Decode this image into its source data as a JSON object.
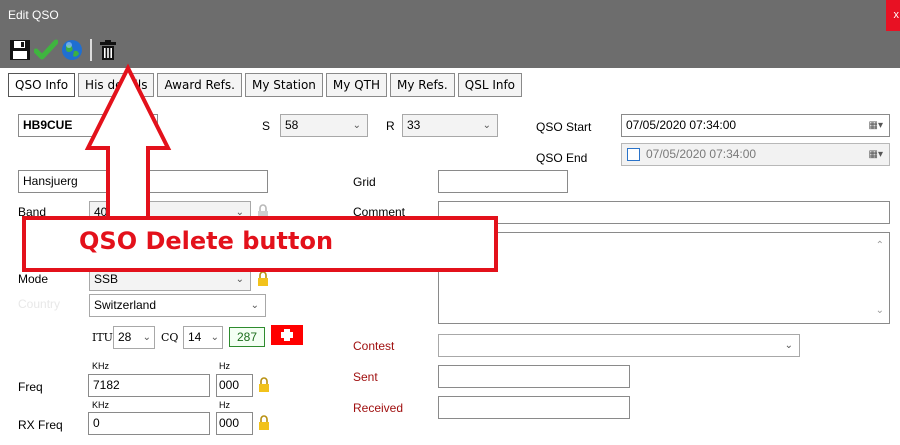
{
  "window": {
    "title": "Edit QSO",
    "close_label": "x"
  },
  "toolbar": {
    "buttons": [
      {
        "name": "save-icon"
      },
      {
        "name": "confirm-check-icon"
      },
      {
        "name": "globe-icon"
      },
      {
        "name": "trash-icon"
      }
    ]
  },
  "tabs": [
    "QSO Info",
    "His details",
    "Award Refs.",
    "My Station",
    "My QTH",
    "My Refs.",
    "QSL Info"
  ],
  "form": {
    "callsign": "HB9CUE",
    "s_label": "S",
    "s_value": "58",
    "r_label": "R",
    "r_value": "33",
    "qso_start_label": "QSO Start",
    "qso_start_value": "07/05/2020 07:34:00",
    "qso_end_label": "QSO End",
    "qso_end_value": "07/05/2020 07:34:00",
    "name": "Hansjuerg",
    "grid_label": "Grid",
    "grid_value": "",
    "band_label": "Band",
    "band_value": "40m",
    "comment_label": "Comment",
    "comment_value": "",
    "mode_label": "Mode",
    "mode_value": "SSB",
    "country_label": "Country",
    "country_value": "Switzerland",
    "itu_label": "ITU",
    "itu_value": "28",
    "cq_label": "CQ",
    "cq_value": "14",
    "dxcc_value": "287",
    "contest_label": "Contest",
    "contest_value": "",
    "sent_label": "Sent",
    "sent_value": "",
    "received_label": "Received",
    "received_value": "",
    "freq_label": "Freq",
    "freq_khz_label": "KHz",
    "freq_khz_value": "7182",
    "freq_hz_label": "Hz",
    "freq_hz_value": "000",
    "rxfreq_label": "RX Freq",
    "rxfreq_khz_label": "KHz",
    "rxfreq_khz_value": "0",
    "rxfreq_hz_label": "Hz",
    "rxfreq_hz_value": "000"
  },
  "annotation": {
    "text": "QSO Delete button",
    "color": "#e3111b"
  },
  "colors": {
    "titlebar": "#6d6d6d",
    "close": "#e81123",
    "dxcc_border": "#2e8b2e",
    "flag_red": "#ff0000"
  }
}
